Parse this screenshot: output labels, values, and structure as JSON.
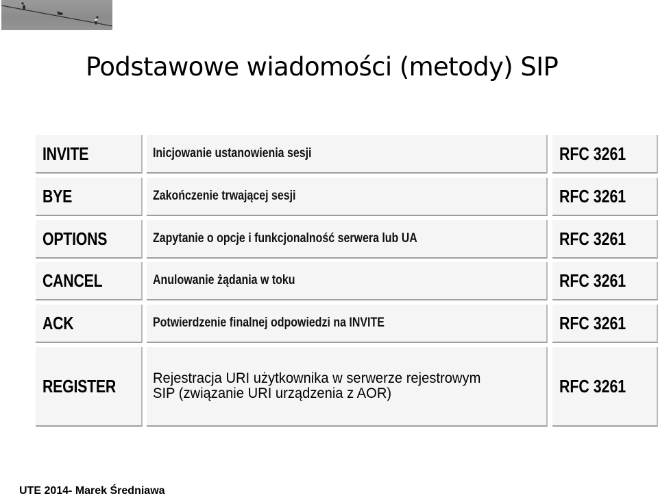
{
  "slide": {
    "title": "Podstawowe wiadomości (metody) SIP",
    "footer": "UTE 2014-  Marek Średniawa",
    "corner_image": "birds-on-wire-photo"
  },
  "table": {
    "rows": [
      {
        "method": "INVITE",
        "description": "Inicjowanie ustanowienia sesji",
        "rfc": "RFC 3261"
      },
      {
        "method": "BYE",
        "description": "Zakończenie trwającej sesji",
        "rfc": "RFC 3261"
      },
      {
        "method": "OPTIONS",
        "description": "Zapytanie o opcje i funkcjonalność serwera lub UA",
        "rfc": "RFC 3261"
      },
      {
        "method": "CANCEL",
        "description": "Anulowanie żądania w toku",
        "rfc": "RFC 3261"
      },
      {
        "method": "ACK",
        "description": "Potwierdzenie finalnej odpowiedzi na INVITE",
        "rfc": "RFC 3261"
      },
      {
        "method": "REGISTER",
        "description_lines": [
          "Rejestracja URI użytkownika w serwerze rejestrowym",
          "SIP (związanie URI urządzenia z AOR)"
        ],
        "rfc": "RFC 3261"
      }
    ]
  }
}
